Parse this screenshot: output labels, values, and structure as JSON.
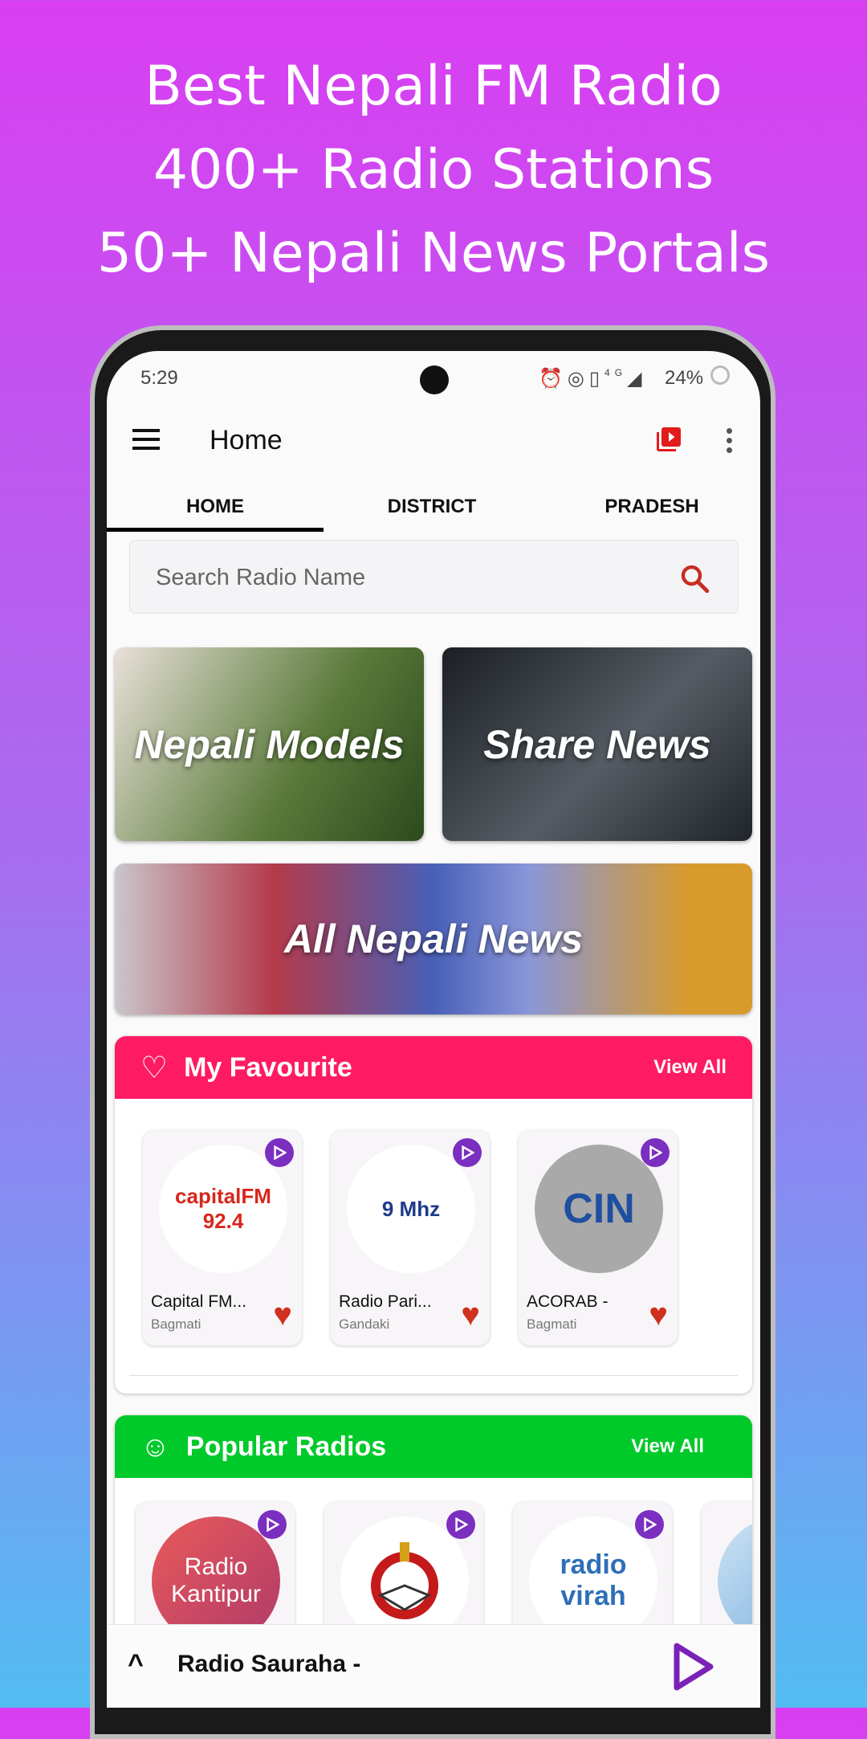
{
  "promo": {
    "line1": "Best Nepali FM Radio",
    "line2": "400+ Radio Stations",
    "line3": "50+ Nepali News Portals"
  },
  "status_bar": {
    "time": "5:29",
    "network": "4G",
    "battery": "24%"
  },
  "app_bar": {
    "title": "Home"
  },
  "tabs": [
    {
      "label": "HOME",
      "active": true
    },
    {
      "label": "DISTRICT"
    },
    {
      "label": "PRADESH"
    }
  ],
  "search": {
    "placeholder": "Search Radio Name"
  },
  "banners": [
    {
      "label": "Nepali Models"
    },
    {
      "label": "Share News"
    },
    {
      "label": "All Nepali News"
    }
  ],
  "favourites": {
    "title": "My Favourite",
    "view_all": "View All",
    "color": "#fe1b63",
    "items": [
      {
        "name": "Capital FM...",
        "province": "Bagmati",
        "logo": "capitalFM 92.4"
      },
      {
        "name": "Radio Pari...",
        "province": "Gandaki",
        "logo": "9 Mhz"
      },
      {
        "name": "ACORAB -",
        "province": "Bagmati",
        "logo": "CIN"
      }
    ]
  },
  "popular": {
    "title": "Popular Radios",
    "view_all": "View All",
    "color": "#00c92a",
    "items": [
      {
        "logo": "Radio Kantipur"
      },
      {
        "logo": ""
      },
      {
        "logo": "radio virah"
      }
    ]
  },
  "player": {
    "station": "Radio Sauraha -"
  }
}
